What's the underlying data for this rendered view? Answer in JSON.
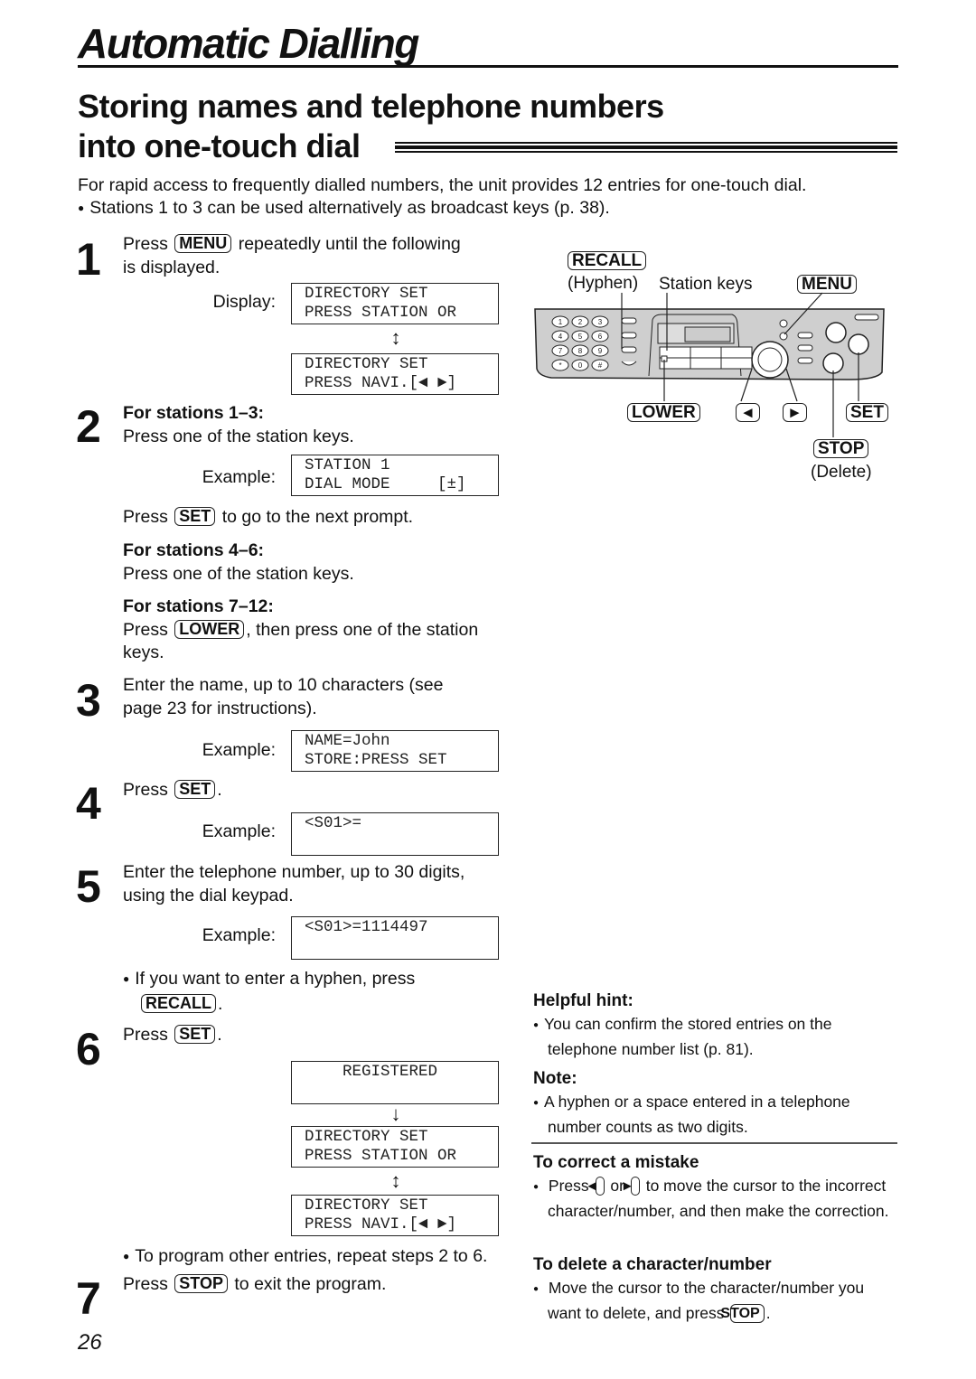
{
  "header": {
    "title": "Automatic Dialling",
    "section_title_line1": "Storing names and telephone numbers",
    "section_title_line2": "into one-touch dial"
  },
  "intro": {
    "paragraph": "For rapid access to frequently dialled numbers, the unit provides 12 entries for one-touch dial.",
    "bullet": "Stations 1 to 3 can be used alternatively as broadcast keys (p. 38)."
  },
  "keys": {
    "menu": "MENU",
    "set": "SET",
    "lower": "LOWER",
    "recall": "RECALL",
    "stop": "STOP",
    "left": "◄",
    "right": "►"
  },
  "steps": {
    "s1": {
      "num": "1",
      "pre": "Press",
      "post": "repeatedly until the following",
      "line2": "is displayed.",
      "label": "Display:",
      "lcd1": "DIRECTORY SET\nPRESS STATION OR",
      "arrow": "↕",
      "lcd2": "DIRECTORY SET\nPRESS NAVI.[◄ ►]"
    },
    "s2": {
      "num": "2",
      "head1": "For stations 1–3:",
      "text1": "Press one of the station keys.",
      "label": "Example:",
      "lcd": "STATION 1\nDIAL MODE     [±]",
      "press_pre": "Press",
      "press_post": "to go to the next prompt.",
      "head2": "For stations 4–6:",
      "text2": "Press one of the station keys.",
      "head3": "For stations 7–12:",
      "text3_pre": "Press",
      "text3_post": ", then press one of the station",
      "text3_line2": "keys."
    },
    "s3": {
      "num": "3",
      "line1": "Enter the name, up to 10 characters (see",
      "line2": "page 23 for instructions).",
      "label": "Example:",
      "lcd": "NAME=John\nSTORE:PRESS SET"
    },
    "s4": {
      "num": "4",
      "pre": "Press",
      "post": ".",
      "label": "Example:",
      "lcd": "<S01>="
    },
    "s5": {
      "num": "5",
      "line1": "Enter the telephone number, up to 30 digits,",
      "line2": "using the dial keypad.",
      "label": "Example:",
      "lcd": "<S01>=1114497",
      "bullet": "If you want to enter a hyphen, press",
      "bullet_post": "."
    },
    "s6": {
      "num": "6",
      "pre": "Press",
      "post": ".",
      "lcd1": "    REGISTERED",
      "arrow1": "↓",
      "lcd2": "DIRECTORY SET\nPRESS STATION OR",
      "arrow2": "↕",
      "lcd3": "DIRECTORY SET\nPRESS NAVI.[◄ ►]",
      "bullet": "To program other entries, repeat steps 2 to 6."
    },
    "s7": {
      "num": "7",
      "pre": "Press",
      "post": "to exit the program."
    }
  },
  "diagram": {
    "recall_label": "RECALL",
    "hyphen_caption": "(Hyphen)",
    "station_keys_caption": "Station keys",
    "menu_label": "MENU",
    "lower_label": "LOWER",
    "left_label": "◄",
    "right_label": "►",
    "set_label": "SET",
    "stop_label": "STOP",
    "delete_caption": "(Delete)",
    "keypad": [
      "1",
      "2",
      "3",
      "4",
      "5",
      "6",
      "7",
      "8",
      "9",
      "*",
      "0",
      "#"
    ]
  },
  "sidebar": {
    "hint_title": "Helpful hint:",
    "hint_text": "You can confirm the stored entries on the telephone number list (p. 81).",
    "note_title": "Note:",
    "note_text": "A hyphen or a space entered in a telephone number counts as two digits.",
    "correct_title": "To correct a mistake",
    "correct_pre": "Press",
    "correct_or": "or",
    "correct_post": "to move the cursor to the incorrect character/number, and then make the correction.",
    "delete_title": "To delete a character/number",
    "delete_text": "Move the cursor to the character/number you want to delete, and press",
    "delete_post": "."
  },
  "footer": {
    "page_number": "26"
  }
}
